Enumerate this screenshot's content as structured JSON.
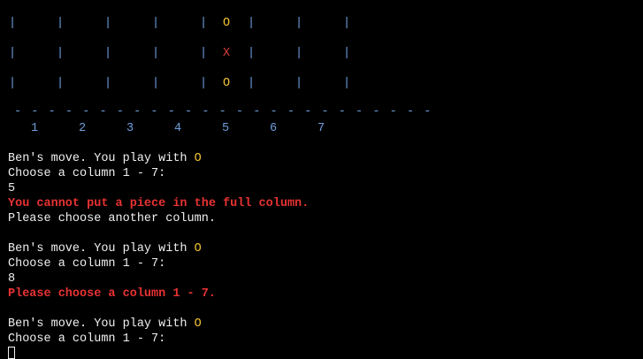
{
  "board": {
    "bar_glyph": "|",
    "rows": [
      [
        "",
        "",
        "",
        "",
        "O",
        "",
        ""
      ],
      [
        "",
        "",
        "",
        "",
        "X",
        "",
        ""
      ],
      [
        "",
        "",
        "",
        "",
        "O",
        "",
        ""
      ]
    ],
    "separator": "- - - - - - - - - - - - - - - - - - - - - - - - -",
    "column_numbers": [
      "1",
      "2",
      "3",
      "4",
      "5",
      "6",
      "7"
    ]
  },
  "colors": {
    "background": "#000000",
    "text": "#f0f0f0",
    "board": "#6f9edc",
    "piece_o": "#f1c232",
    "piece_x": "#e03c3c",
    "error": "#e83232"
  },
  "log": {
    "block1": {
      "move_prefix": "Ben's move. You play with ",
      "move_piece": "O",
      "prompt": "Choose a column 1 - 7:",
      "input": "5",
      "error": "You cannot put a piece in the full column.",
      "info": "Please choose another column."
    },
    "block2": {
      "move_prefix": "Ben's move. You play with ",
      "move_piece": "O",
      "prompt": "Choose a column 1 - 7:",
      "input": "8",
      "error": "Please choose a column 1 - 7."
    },
    "block3": {
      "move_prefix": "Ben's move. You play with ",
      "move_piece": "O",
      "prompt": "Choose a column 1 - 7:"
    }
  }
}
